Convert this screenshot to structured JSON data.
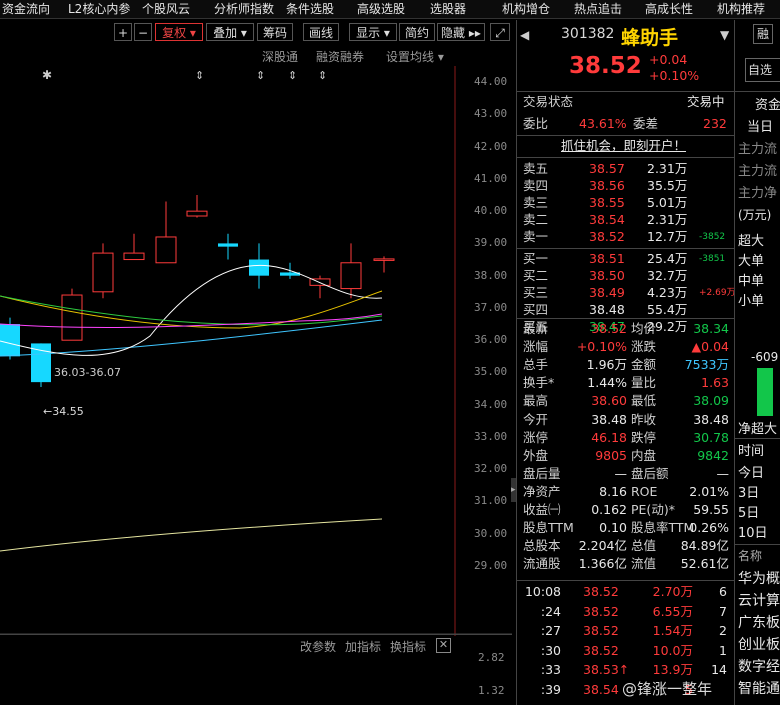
{
  "top_menu": [
    "资金流向",
    "L2核心内参",
    "个股风云",
    "分析师指数",
    "条件选股",
    "高级选股",
    "选股器",
    "机构增仓",
    "热点追击",
    "高成长性",
    "机构推荐"
  ],
  "toolbar": {
    "plus": "+",
    "minus": "−",
    "fuquan": "复权",
    "overlay": "叠加",
    "chips": "筹码",
    "draw": "画线",
    "display": "显示",
    "simple": "简约",
    "hide": "隐藏"
  },
  "sublinks": {
    "sz": "深股通",
    "margin": "融资融券",
    "set_ma": "设置均线"
  },
  "price_axis": [
    "44.00",
    "43.00",
    "42.00",
    "41.00",
    "40.00",
    "39.00",
    "38.00",
    "37.00",
    "36.00",
    "35.00",
    "34.00",
    "33.00",
    "32.00",
    "31.00",
    "30.00",
    "29.00"
  ],
  "chart_annotations": {
    "date_range": "36.03-36.07",
    "low_marker": "←34.55"
  },
  "bottom_links": {
    "params": "改参数",
    "add": "加指标",
    "switch": "换指标"
  },
  "indicator_axis": [
    "2.82",
    "1.32"
  ],
  "chart_data": {
    "type": "candlestick",
    "candles": [
      {
        "o": 36.5,
        "h": 36.7,
        "l": 35.4,
        "c": 35.5
      },
      {
        "o": 35.9,
        "h": 35.9,
        "l": 34.55,
        "c": 34.7
      },
      {
        "o": 36.0,
        "h": 37.6,
        "l": 36.0,
        "c": 37.4
      },
      {
        "o": 37.5,
        "h": 39.0,
        "l": 37.3,
        "c": 38.7
      },
      {
        "o": 38.5,
        "h": 39.3,
        "l": 38.5,
        "c": 38.7
      },
      {
        "o": 38.4,
        "h": 40.3,
        "l": 38.4,
        "c": 39.2
      },
      {
        "o": 39.85,
        "h": 40.5,
        "l": 39.8,
        "c": 40.0
      },
      {
        "o": 39.0,
        "h": 39.3,
        "l": 38.5,
        "c": 38.9
      },
      {
        "o": 38.5,
        "h": 39.0,
        "l": 37.6,
        "c": 38.0
      },
      {
        "o": 38.1,
        "h": 38.4,
        "l": 37.9,
        "c": 38.0
      },
      {
        "o": 37.7,
        "h": 38.0,
        "l": 37.3,
        "c": 37.9
      },
      {
        "o": 37.6,
        "h": 39.0,
        "l": 37.3,
        "c": 38.4
      },
      {
        "o": 38.48,
        "h": 38.6,
        "l": 38.1,
        "c": 38.52
      }
    ],
    "ylim": [
      29,
      44.5
    ]
  },
  "stock": {
    "code": "301382",
    "name": "蜂助手",
    "price": "38.52",
    "change": "+0.04",
    "pct": "+0.10%",
    "rong": "融",
    "zixuan": "自选"
  },
  "trade_status": {
    "label": "交易状态",
    "value": "交易中"
  },
  "wei": {
    "ratio_label": "委比",
    "ratio": "43.61%",
    "diff_label": "委差",
    "diff": "232"
  },
  "promo": "抓住机会，即刻开户！",
  "asks": [
    {
      "label": "卖五",
      "price": "38.57",
      "vol": "2.31万",
      "chg": ""
    },
    {
      "label": "卖四",
      "price": "38.56",
      "vol": "35.5万",
      "chg": ""
    },
    {
      "label": "卖三",
      "price": "38.55",
      "vol": "5.01万",
      "chg": ""
    },
    {
      "label": "卖二",
      "price": "38.54",
      "vol": "2.31万",
      "chg": ""
    },
    {
      "label": "卖一",
      "price": "38.52",
      "vol": "12.7万",
      "chg": "-3852"
    }
  ],
  "bids": [
    {
      "label": "买一",
      "price": "38.51",
      "vol": "25.4万",
      "chg": "-3851"
    },
    {
      "label": "买二",
      "price": "38.50",
      "vol": "32.7万",
      "chg": ""
    },
    {
      "label": "买三",
      "price": "38.49",
      "vol": "4.23万",
      "chg": "+2.69万"
    },
    {
      "label": "买四",
      "price": "38.48",
      "vol": "55.4万",
      "chg": ""
    },
    {
      "label": "买五",
      "price": "38.47",
      "vol": "29.2万",
      "chg": ""
    }
  ],
  "stats": [
    {
      "l1": "最新",
      "v1": "38.52",
      "c1": "red",
      "l2": "均价",
      "v2": "38.34",
      "c2": "green"
    },
    {
      "l1": "涨幅",
      "v1": "+0.10%",
      "c1": "red",
      "l2": "涨跌",
      "v2": "▲0.04",
      "c2": "red"
    },
    {
      "l1": "总手",
      "v1": "1.96万",
      "c1": "white",
      "l2": "金额",
      "v2": "7533万",
      "c2": "cyan"
    },
    {
      "l1": "换手*",
      "v1": "1.44%",
      "c1": "white",
      "l2": "量比",
      "v2": "1.63",
      "c2": "red"
    },
    {
      "l1": "最高",
      "v1": "38.60",
      "c1": "red",
      "l2": "最低",
      "v2": "38.09",
      "c2": "green"
    },
    {
      "l1": "今开",
      "v1": "38.48",
      "c1": "white",
      "l2": "昨收",
      "v2": "38.48",
      "c2": "white"
    },
    {
      "l1": "涨停",
      "v1": "46.18",
      "c1": "red",
      "l2": "跌停",
      "v2": "30.78",
      "c2": "green"
    },
    {
      "l1": "外盘",
      "v1": "9805",
      "c1": "red",
      "l2": "内盘",
      "v2": "9842",
      "c2": "green"
    },
    {
      "l1": "盘后量",
      "v1": "—",
      "c1": "white",
      "l2": "盘后额",
      "v2": "—",
      "c2": "white"
    },
    {
      "l1": "净资产",
      "v1": "8.16",
      "c1": "white",
      "l2": "ROE",
      "v2": "2.01%",
      "c2": "white"
    },
    {
      "l1": "收益㈠",
      "v1": "0.162",
      "c1": "white",
      "l2": "PE(动)*",
      "v2": "59.55",
      "c2": "white"
    },
    {
      "l1": "股息TTM",
      "v1": "0.10",
      "c1": "white",
      "l2": "股息率TTM",
      "v2": "0.26%",
      "c2": "white"
    },
    {
      "l1": "总股本",
      "v1": "2.204亿",
      "c1": "white",
      "l2": "总值",
      "v2": "84.89亿",
      "c2": "white"
    },
    {
      "l1": "流通股",
      "v1": "1.366亿",
      "c1": "white",
      "l2": "流值",
      "v2": "52.61亿",
      "c2": "white"
    }
  ],
  "ticks": [
    {
      "time": "10:08",
      "price": "38.52",
      "vol": "2.70万",
      "n": "6"
    },
    {
      "time": ":24",
      "price": "38.52",
      "vol": "6.55万",
      "n": "7"
    },
    {
      "time": ":27",
      "price": "38.52",
      "vol": "1.54万",
      "n": "2"
    },
    {
      "time": ":30",
      "price": "38.52",
      "vol": "10.0万",
      "n": "1"
    },
    {
      "time": ":33",
      "price": "38.53↑",
      "vol": "13.9万",
      "n": "14"
    },
    {
      "time": ":39",
      "price": "38.54",
      "vol": "5",
      "n": ""
    }
  ],
  "far_right": {
    "tab": "资金",
    "sub": "当日",
    "flows": [
      "主力流",
      "主力流",
      "主力净"
    ],
    "unit": "(万元)",
    "sizes": [
      "超大",
      "大单",
      "中单",
      "小单"
    ],
    "bar_value": "-609",
    "net": "净超大",
    "time_label": "时间",
    "periods": [
      "今日",
      "3日",
      "5日",
      "10日"
    ],
    "name_label": "名称",
    "names": [
      "华为概",
      "云计算",
      "广东板",
      "创业板",
      "数字经",
      "智能通"
    ]
  },
  "watermark": "@锋涨一整年",
  "colors": {
    "up": "#ff3b3b",
    "down": "#12c64a",
    "accent": "#3fc6ff"
  }
}
